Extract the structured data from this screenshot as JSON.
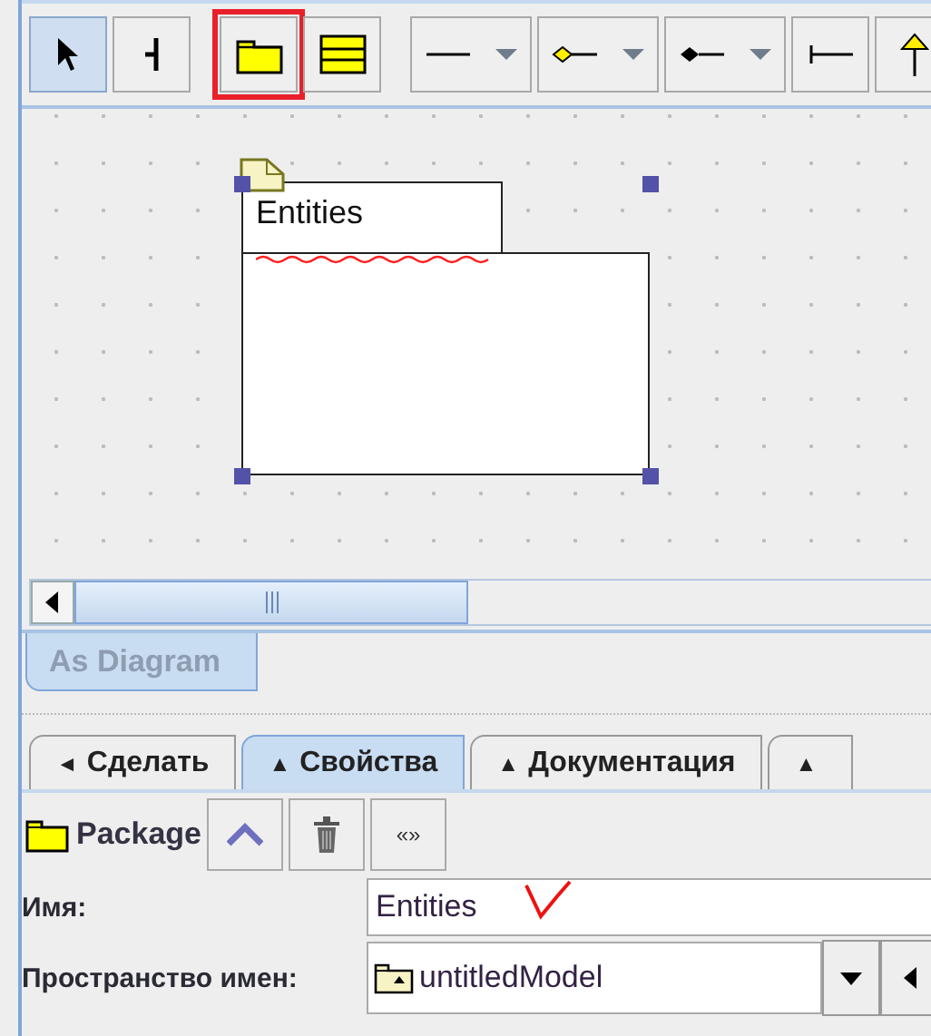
{
  "toolbar": {
    "tools": [
      {
        "kind": "select",
        "selected": true,
        "highlighted": false
      },
      {
        "kind": "junction",
        "selected": false,
        "highlighted": false
      },
      {
        "kind": "package",
        "selected": false,
        "highlighted": true
      },
      {
        "kind": "class",
        "selected": false,
        "highlighted": false
      },
      {
        "kind": "line-menu",
        "selected": false,
        "highlighted": false
      },
      {
        "kind": "aggregation-menu",
        "selected": false,
        "highlighted": false
      },
      {
        "kind": "composition-menu",
        "selected": false,
        "highlighted": false
      },
      {
        "kind": "bar-line",
        "selected": false,
        "highlighted": false
      },
      {
        "kind": "generalization",
        "selected": false,
        "highlighted": false
      }
    ]
  },
  "diagram": {
    "package": {
      "name": "Entities",
      "selected": true,
      "misspelled": true
    }
  },
  "view_tabs": [
    {
      "label": "As Diagram",
      "selected": true
    }
  ],
  "detail_tabs": [
    {
      "icon": "◄",
      "label": "Сделать",
      "selected": false
    },
    {
      "icon": "▲",
      "label": "Свойства",
      "selected": true
    },
    {
      "icon": "▲",
      "label": "Документация",
      "selected": false
    },
    {
      "icon": "▲",
      "selected": false
    }
  ],
  "properties": {
    "element_type": "Package",
    "buttons": [
      {
        "kind": "up"
      },
      {
        "kind": "delete"
      },
      {
        "kind": "stereotype",
        "label": "«»"
      }
    ],
    "fields": [
      {
        "kind": "text",
        "label": "Имя:",
        "value": "Entities"
      },
      {
        "kind": "combo",
        "label": "Пространство имен:",
        "value": "untitledModel"
      }
    ]
  },
  "annotations": [
    {
      "kind": "check"
    }
  ]
}
